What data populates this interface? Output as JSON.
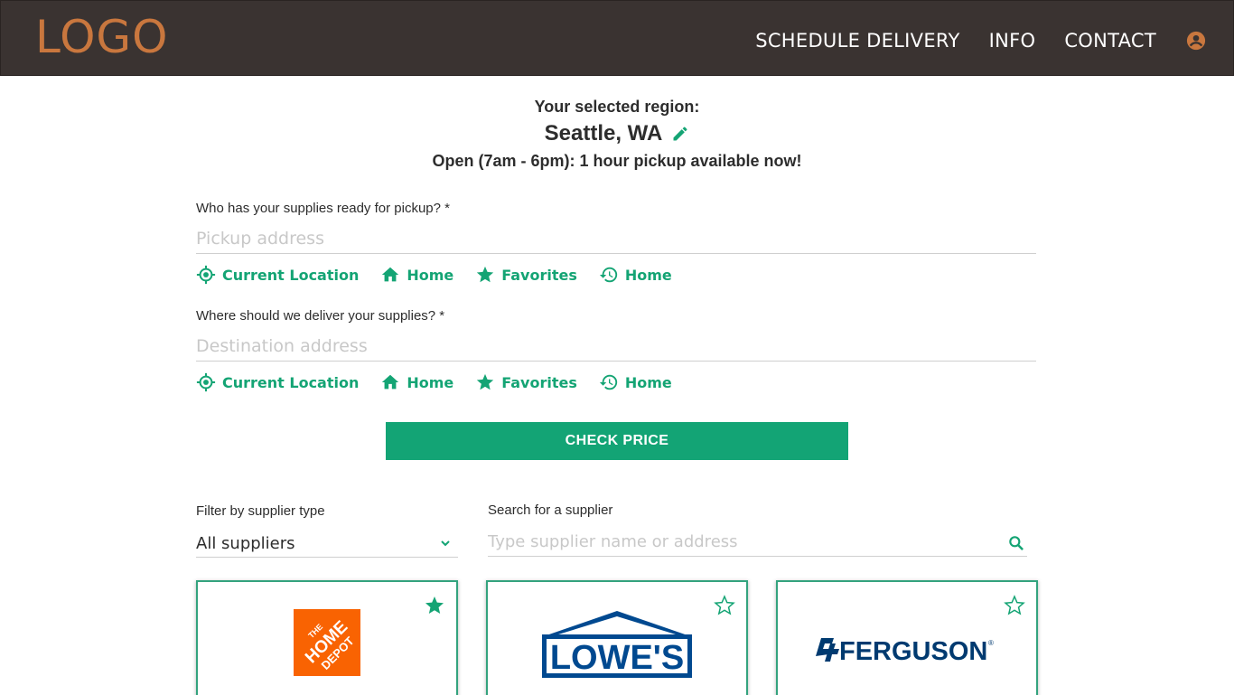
{
  "header": {
    "logo": "LOGO",
    "nav": [
      "SCHEDULE DELIVERY",
      "INFO",
      "CONTACT"
    ],
    "user_icon": "account-circle-icon"
  },
  "region": {
    "label": "Your selected region:",
    "city": "Seattle, WA",
    "hours": "Open (7am - 6pm): 1 hour pickup available now!"
  },
  "pickup": {
    "label": "Who has your supplies ready for pickup? *",
    "placeholder": "Pickup address",
    "chips": [
      "Current Location",
      "Home",
      "Favorites",
      "Home"
    ]
  },
  "delivery": {
    "label": "Where should we deliver your supplies? *",
    "placeholder": "Destination address",
    "chips": [
      "Current Location",
      "Home",
      "Favorites",
      "Home"
    ]
  },
  "check_price": "CHECK PRICE",
  "filter": {
    "label": "Filter by supplier type",
    "value": "All suppliers"
  },
  "search": {
    "label": "Search for a supplier",
    "placeholder": "Type supplier name or address"
  },
  "suppliers": [
    {
      "name": "THE HOME DEPOT",
      "favorite": true
    },
    {
      "name": "LOWE'S",
      "favorite": false
    },
    {
      "name": "FERGUSON",
      "favorite": false
    }
  ],
  "colors": {
    "header_bg": "#3a3331",
    "logo": "#c9773e",
    "accent": "#13a475",
    "home_depot": "#f96302",
    "lowes": "#004990",
    "ferguson": "#003a70"
  }
}
